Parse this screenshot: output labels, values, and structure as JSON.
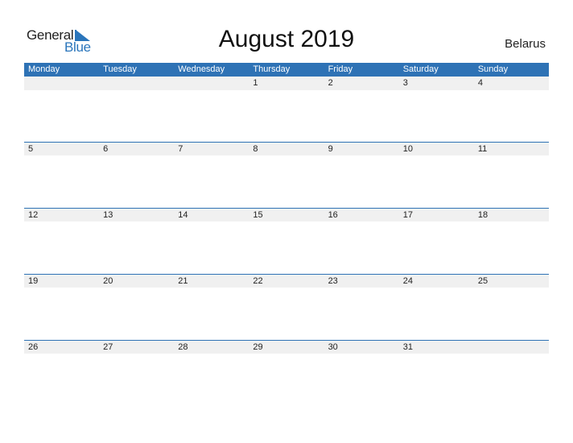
{
  "logo": {
    "line1": "General",
    "line2": "Blue"
  },
  "title": "August 2019",
  "country": "Belarus",
  "colors": {
    "header": "#2e72b5",
    "band": "#f0f0f0",
    "logo_blue": "#2a75bb"
  },
  "weekdays": [
    "Monday",
    "Tuesday",
    "Wednesday",
    "Thursday",
    "Friday",
    "Saturday",
    "Sunday"
  ],
  "weeks": [
    [
      "",
      "",
      "",
      "1",
      "2",
      "3",
      "4"
    ],
    [
      "5",
      "6",
      "7",
      "8",
      "9",
      "10",
      "11"
    ],
    [
      "12",
      "13",
      "14",
      "15",
      "16",
      "17",
      "18"
    ],
    [
      "19",
      "20",
      "21",
      "22",
      "23",
      "24",
      "25"
    ],
    [
      "26",
      "27",
      "28",
      "29",
      "30",
      "31",
      ""
    ]
  ]
}
